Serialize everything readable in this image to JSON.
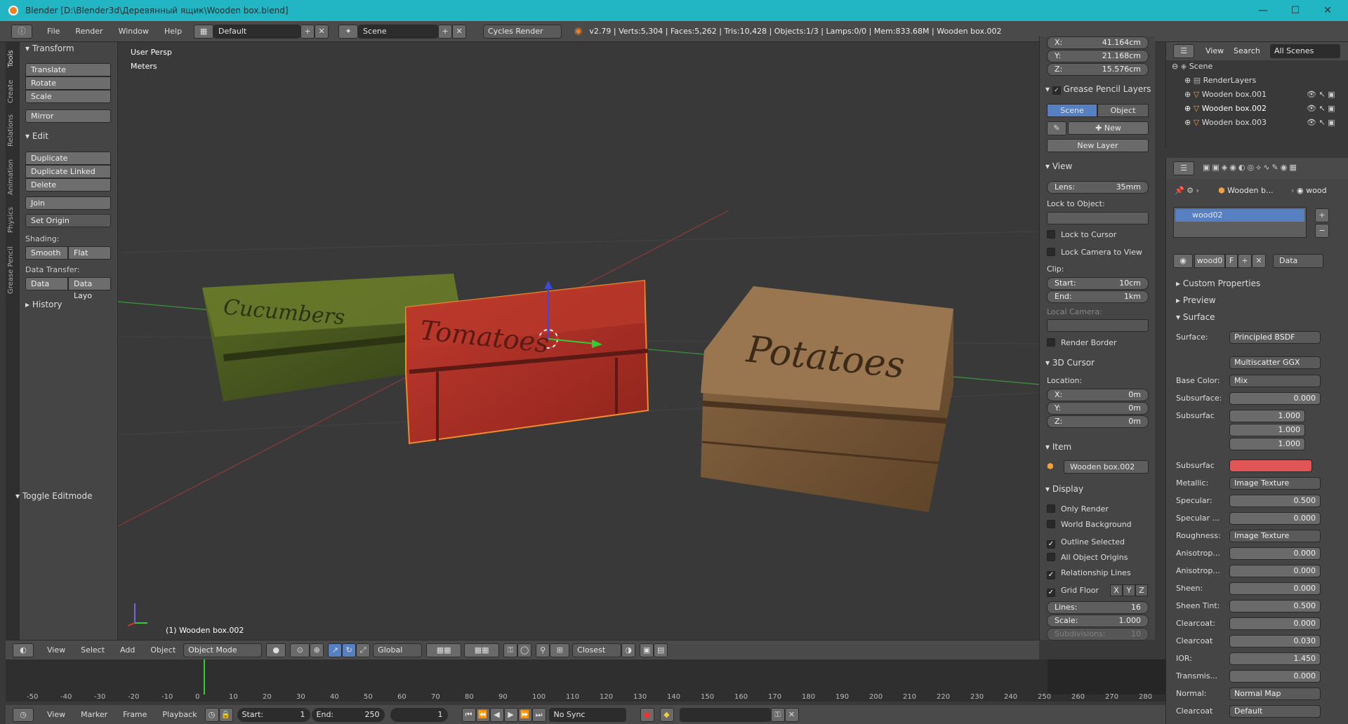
{
  "window": {
    "title": "Blender [D:\\Blender3d\\Деревянный ящик\\Wooden box.blend]",
    "minimize": "—",
    "maximize": "☐",
    "close": "✕"
  },
  "menu": {
    "items": [
      "File",
      "Render",
      "Window",
      "Help"
    ],
    "layout": "Default",
    "scene": "Scene",
    "engine": "Cycles Render",
    "stats": "v2.79 | Verts:5,304 | Faces:5,262 | Tris:10,428 | Objects:1/3 | Lamps:0/0 | Mem:833.68M | Wooden box.002"
  },
  "tabs": [
    "Tools",
    "Create",
    "Relations",
    "Animation",
    "Physics",
    "Grease Pencil"
  ],
  "toolshelf": {
    "transform_header": "Transform",
    "translate": "Translate",
    "rotate": "Rotate",
    "scale": "Scale",
    "mirror": "Mirror",
    "edit_header": "Edit",
    "duplicate": "Duplicate",
    "duplicate_linked": "Duplicate Linked",
    "delete": "Delete",
    "join": "Join",
    "set_origin": "Set Origin",
    "shading_label": "Shading:",
    "smooth": "Smooth",
    "flat": "Flat",
    "data_transfer_label": "Data Transfer:",
    "data": "Data",
    "data_layo": "Data Layo",
    "history": "History",
    "toggle_editmode": "Toggle Editmode"
  },
  "viewport": {
    "view_name": "User Persp",
    "units": "Meters",
    "selected_label": "(1) Wooden box.002",
    "crate_labels": [
      "Cucumbers",
      "Tomatoes",
      "Potatoes"
    ]
  },
  "view_header": {
    "view": "View",
    "select": "Select",
    "add": "Add",
    "object": "Object",
    "mode": "Object Mode",
    "orientation": "Global",
    "snap": "Closest"
  },
  "timeline": {
    "ticks": [
      "-50",
      "-40",
      "-30",
      "-20",
      "-10",
      "0",
      "10",
      "20",
      "30",
      "40",
      "50",
      "60",
      "70",
      "80",
      "90",
      "100",
      "110",
      "120",
      "130",
      "140",
      "150",
      "160",
      "170",
      "180",
      "190",
      "200",
      "210",
      "220",
      "230",
      "240",
      "250",
      "260",
      "270",
      "280"
    ],
    "view": "View",
    "marker": "Marker",
    "frame": "Frame",
    "playback": "Playback",
    "start_label": "Start:",
    "start": "1",
    "end_label": "End:",
    "end": "250",
    "current": "1",
    "sync": "No Sync"
  },
  "npanel": {
    "loc_x_label": "X:",
    "loc_x": "41.164cm",
    "loc_y_label": "Y:",
    "loc_y": "21.168cm",
    "loc_z_label": "Z:",
    "loc_z": "15.576cm",
    "gp_layers": "Grease Pencil Layers",
    "scene_tab": "Scene",
    "object_tab": "Object",
    "new": "New",
    "new_layer": "New Layer",
    "view_header": "View",
    "lens_label": "Lens:",
    "lens": "35mm",
    "lock_to_object": "Lock to Object:",
    "lock_to_cursor": "Lock to Cursor",
    "lock_camera": "Lock Camera to View",
    "clip": "Clip:",
    "start_label": "Start:",
    "clip_start": "10cm",
    "end_label": "End:",
    "clip_end": "1km",
    "local_camera": "Local Camera:",
    "render_border": "Render Border",
    "cursor_header": "3D Cursor",
    "location": "Location:",
    "cx_label": "X:",
    "cx": "0m",
    "cy_label": "Y:",
    "cy": "0m",
    "cz_label": "Z:",
    "cz": "0m",
    "item_header": "Item",
    "item_name": "Wooden box.002",
    "display_header": "Display",
    "only_render": "Only Render",
    "world_bg": "World Background",
    "outline_selected": "Outline Selected",
    "all_origins": "All Object Origins",
    "relationship_lines": "Relationship Lines",
    "grid_floor": "Grid Floor",
    "axis_x": "X",
    "axis_y": "Y",
    "axis_z": "Z",
    "lines_label": "Lines:",
    "lines": "16",
    "scale_label": "Scale:",
    "scale": "1.000",
    "subdiv_label": "Subdivisions:",
    "subdiv": "10"
  },
  "outliner": {
    "view": "View",
    "search": "Search",
    "filter": "All Scenes",
    "items": [
      "Scene",
      "RenderLayers",
      "Wooden box.001",
      "Wooden box.002",
      "Wooden box.003"
    ]
  },
  "properties": {
    "breadcrumb_obj": "Wooden b...",
    "breadcrumb_mat": "wood",
    "material_slot": "wood02",
    "mat_name": "wood0",
    "fake_user": "F",
    "link": "Data",
    "custom_props": "Custom Properties",
    "preview": "Preview",
    "surface_header": "Surface",
    "surface_label": "Surface:",
    "surface": "Principled BSDF",
    "distribution": "Multiscatter GGX",
    "base_color_label": "Base Color:",
    "base_color": "Mix",
    "subsurface_label": "Subsurface:",
    "subsurface": "0.000",
    "subsurf_radius_label": "Subsurfac",
    "r1": "1.000",
    "r2": "1.000",
    "r3": "1.000",
    "subsurf_color_label": "Subsurfac",
    "subsurf_color": "#e05555",
    "metallic_label": "Metallic:",
    "metallic": "Image Texture",
    "specular_label": "Specular:",
    "specular": "0.500",
    "spec_tint_label": "Specular ...",
    "spec_tint": "0.000",
    "roughness_label": "Roughness:",
    "roughness": "Image Texture",
    "aniso_label": "Anisotrop...",
    "aniso": "0.000",
    "aniso_rot_label": "Anisotrop...",
    "aniso_rot": "0.000",
    "sheen_label": "Sheen:",
    "sheen": "0.000",
    "sheen_tint_label": "Sheen Tint:",
    "sheen_tint": "0.500",
    "clearcoat_label": "Clearcoat:",
    "clearcoat": "0.000",
    "cc_rough_label": "Clearcoat",
    "cc_rough": "0.030",
    "ior_label": "IOR:",
    "ior": "1.450",
    "transmis_label": "Transmis...",
    "transmis": "0.000",
    "normal_label": "Normal:",
    "normal": "Normal Map",
    "cc_normal_label": "Clearcoat",
    "cc_normal": "Default"
  }
}
